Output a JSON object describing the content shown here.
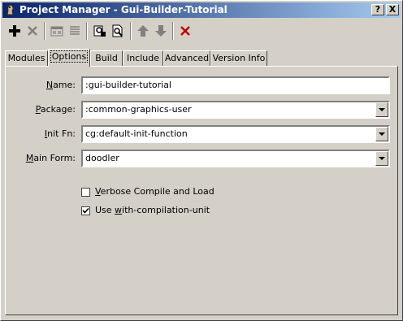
{
  "window": {
    "title": "Project Manager - Gui-Builder-Tutorial",
    "help_button": "?",
    "close_button": "X"
  },
  "toolbar": {
    "buttons": [
      "add-icon",
      "remove-icon",
      "view-icon",
      "list-icon",
      "find-icon",
      "search-file-icon",
      "move-up-icon",
      "move-down-icon",
      "delete-icon"
    ]
  },
  "tabs": [
    {
      "label": "Modules",
      "active": false
    },
    {
      "label": "Options",
      "active": true
    },
    {
      "label": "Build",
      "active": false
    },
    {
      "label": "Include",
      "active": false
    },
    {
      "label": "Advanced",
      "active": false
    },
    {
      "label": "Version Info",
      "active": false
    }
  ],
  "form": {
    "name": {
      "label_pre": "",
      "label_u": "N",
      "label_post": "ame:",
      "value": ":gui-builder-tutorial"
    },
    "package": {
      "label_pre": "",
      "label_u": "P",
      "label_post": "ackage:",
      "value": ":common-graphics-user"
    },
    "init_fn": {
      "label_pre": "",
      "label_u": "I",
      "label_post": "nit Fn:",
      "value": "cg:default-init-function"
    },
    "main_form": {
      "label_pre": "",
      "label_u": "M",
      "label_post": "ain Form:",
      "value": "doodler"
    }
  },
  "options": {
    "verbose": {
      "label_u": "V",
      "label_post": "erbose Compile and Load",
      "checked": false
    },
    "with_compilation": {
      "label_pre": "Use ",
      "label_u": "w",
      "label_post": "ith-compilation-unit",
      "checked": true
    }
  }
}
